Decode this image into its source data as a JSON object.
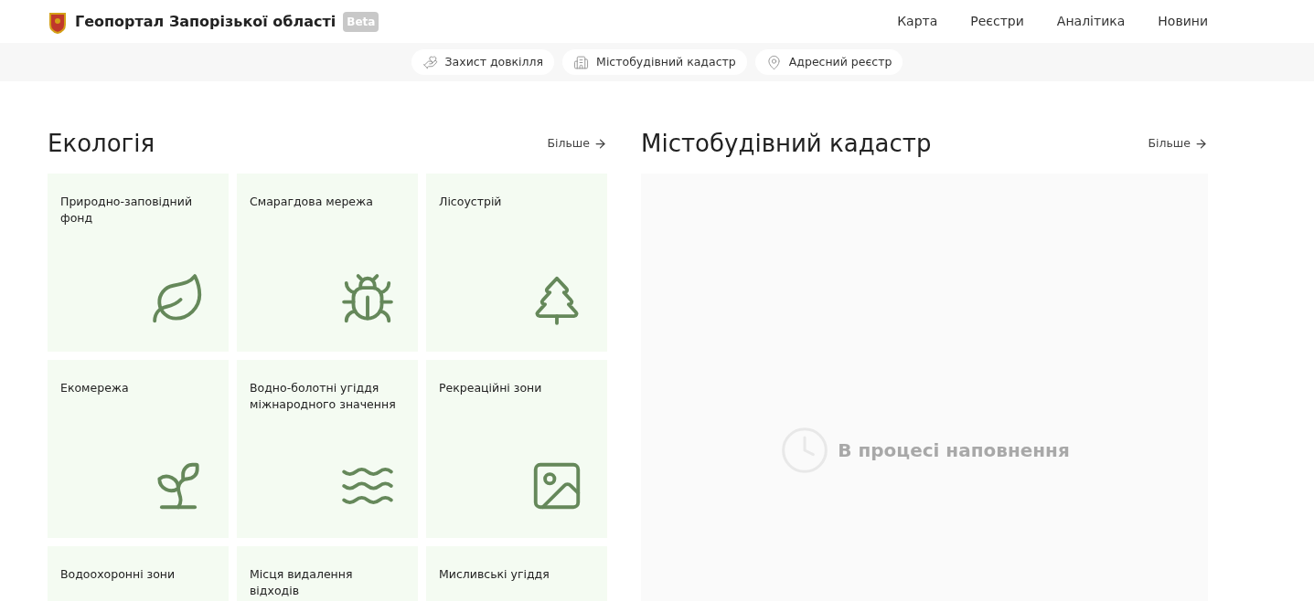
{
  "header": {
    "title": "Геопортал Запорізької області",
    "badge": "Beta",
    "nav": [
      "Карта",
      "Реєстри",
      "Аналітика",
      "Новини"
    ]
  },
  "subnav": [
    "Захист довкілля",
    "Містобудівний кадастр",
    "Адресний реєстр"
  ],
  "ecology": {
    "title": "Екологія",
    "more": "Більше",
    "cards": [
      {
        "label": "Природно-заповідний фонд"
      },
      {
        "label": "Смарагдова мережа"
      },
      {
        "label": "Лісоустрій"
      },
      {
        "label": "Екомережа"
      },
      {
        "label": "Водно-болотні угіддя міжнародного значення"
      },
      {
        "label": "Рекреаційні зони"
      },
      {
        "label": "Водоохоронні зони"
      },
      {
        "label": "Місця видалення відходів"
      },
      {
        "label": "Мисливські угіддя"
      }
    ]
  },
  "cadastre": {
    "title": "Містобудівний кадастр",
    "more": "Більше",
    "status": "В процесі наповнення"
  }
}
